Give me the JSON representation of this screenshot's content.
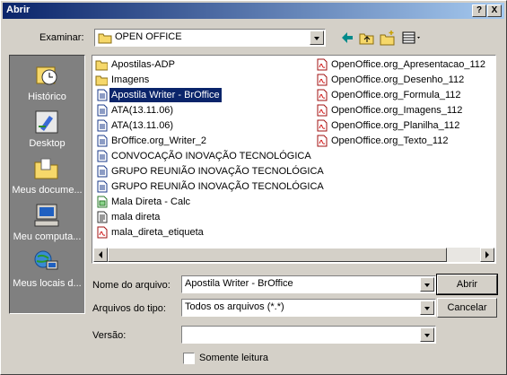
{
  "title": "Abrir",
  "title_buttons": {
    "help": "?",
    "close": "X"
  },
  "examinar": {
    "label": "Examinar:",
    "value": "OPEN OFFICE"
  },
  "places": [
    {
      "label": "Histórico",
      "icon": "history-icon"
    },
    {
      "label": "Desktop",
      "icon": "desktop-icon"
    },
    {
      "label": "Meus docume...",
      "icon": "my-documents-icon"
    },
    {
      "label": "Meu computa...",
      "icon": "my-computer-icon"
    },
    {
      "label": "Meus locais d...",
      "icon": "network-places-icon"
    }
  ],
  "files": [
    {
      "name": "Apostilas-ADP",
      "icon": "folder-icon"
    },
    {
      "name": "Imagens",
      "icon": "folder-icon"
    },
    {
      "name": "Apostila Writer - BrOffice",
      "icon": "writer-doc-icon",
      "selected": true
    },
    {
      "name": "ATA(13.11.06)",
      "icon": "writer-doc-icon"
    },
    {
      "name": "ATA(13.11.06)",
      "icon": "writer-doc-icon"
    },
    {
      "name": "BrOffice.org_Writer_2",
      "icon": "writer-doc-icon"
    },
    {
      "name": "CONVOCAÇÃO INOVAÇÃO TECNOLÓGICA",
      "icon": "writer-doc-icon"
    },
    {
      "name": "GRUPO REUNIÃO INOVAÇÃO TECNOLÓGICA",
      "icon": "writer-doc-icon"
    },
    {
      "name": "GRUPO REUNIÃO INOVAÇÃO TECNOLÓGICA",
      "icon": "writer-doc-icon"
    },
    {
      "name": "Mala Direta - Calc",
      "icon": "calc-doc-icon"
    },
    {
      "name": "mala direta",
      "icon": "text-doc-icon"
    },
    {
      "name": "mala_direta_etiqueta",
      "icon": "pdf-icon"
    },
    {
      "name": "OpenOffice.org_Apresentacao_112",
      "icon": "pdf-icon"
    },
    {
      "name": "OpenOffice.org_Desenho_112",
      "icon": "pdf-icon"
    },
    {
      "name": "OpenOffice.org_Formula_112",
      "icon": "pdf-icon"
    },
    {
      "name": "OpenOffice.org_Imagens_112",
      "icon": "pdf-icon"
    },
    {
      "name": "OpenOffice.org_Planilha_112",
      "icon": "pdf-icon"
    },
    {
      "name": "OpenOffice.org_Texto_112",
      "icon": "pdf-icon"
    }
  ],
  "filename": {
    "label": "Nome do arquivo:",
    "value": "Apostila Writer - BrOffice"
  },
  "filetype": {
    "label": "Arquivos do tipo:",
    "value": "Todos os arquivos (*.*)"
  },
  "version": {
    "label": "Versão:",
    "value": ""
  },
  "readonly_label": "Somente leitura",
  "buttons": {
    "open": "Abrir",
    "cancel": "Cancelar"
  }
}
